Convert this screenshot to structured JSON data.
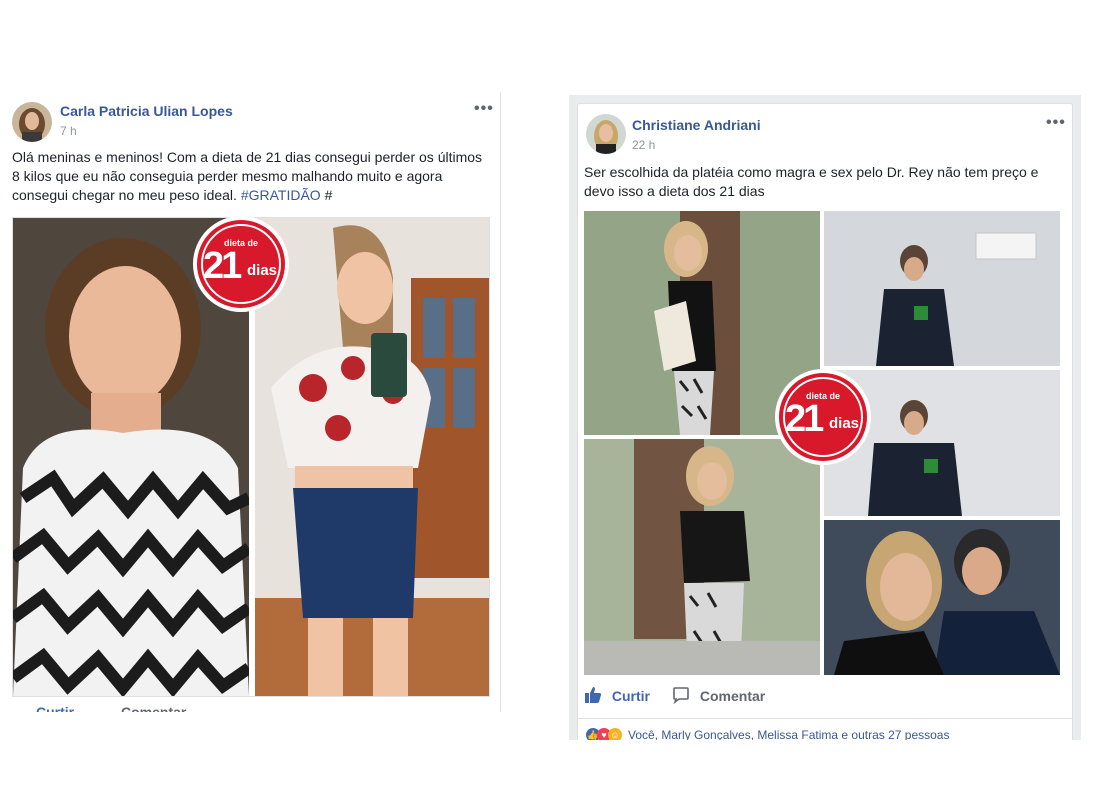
{
  "post1": {
    "author": "Carla Patricia Ulian Lopes",
    "time": "7 h",
    "more": "•••",
    "text": "Olá meninas e meninos! Com a dieta de 21 dias consegui perder os últimos 8 kilos que eu não conseguia perder mesmo malhando muito e agora consegui chegar no meu peso ideal.",
    "hashtag": "#GRATIDÃO",
    "hash_suffix": " #",
    "like_label": "Curtir",
    "comment_label": "Comentar"
  },
  "post2": {
    "author": "Christiane Andriani",
    "time": "22 h",
    "more": "•••",
    "text": "Ser escolhida da platéia como magra e sex pelo Dr. Rey não tem preço e devo isso a dieta dos 21 dias",
    "like_label": "Curtir",
    "comment_label": "Comentar",
    "reactions_text": "Você, Marly Gonçalves, Melissa Fatima e outras 27 pessoas"
  },
  "badge": {
    "small": "dieta de",
    "number": "21",
    "word": "dias"
  },
  "colors": {
    "brand_link": "#385898",
    "like_blue": "#4267b2",
    "badge_red": "#d7192b",
    "feed_bg": "#e9ebee"
  }
}
